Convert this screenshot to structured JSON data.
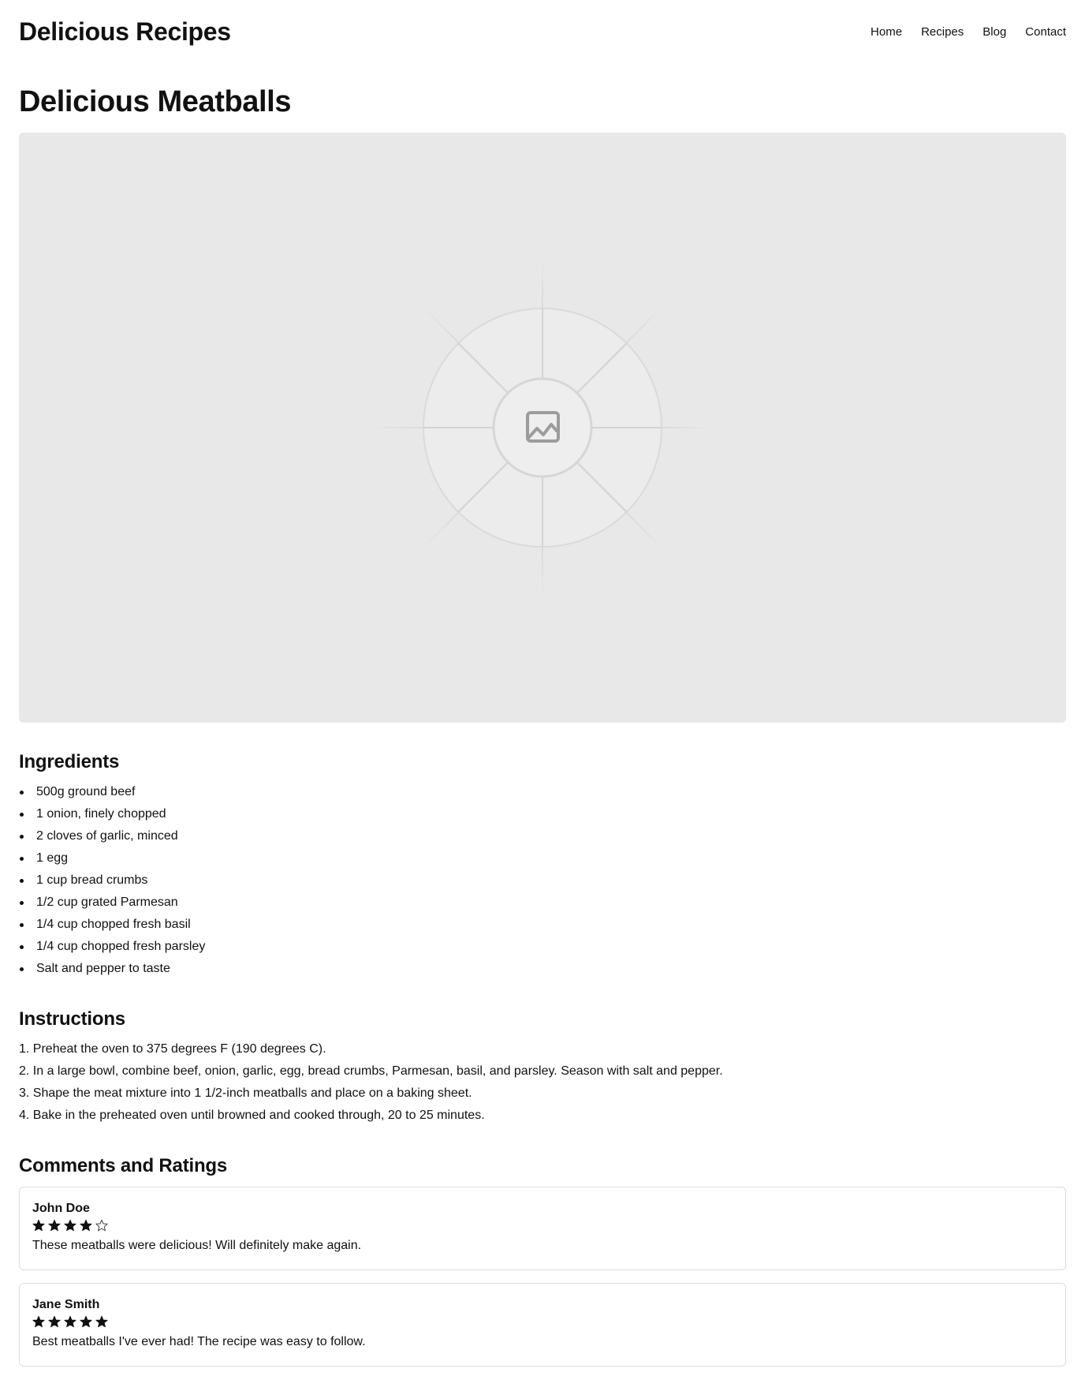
{
  "site": {
    "title": "Delicious Recipes"
  },
  "nav": {
    "items": [
      "Home",
      "Recipes",
      "Blog",
      "Contact"
    ]
  },
  "recipe": {
    "title": "Delicious Meatballs",
    "image_icon": "image-icon",
    "ingredients_heading": "Ingredients",
    "ingredients": [
      "500g ground beef",
      "1 onion, finely chopped",
      "2 cloves of garlic, minced",
      "1 egg",
      "1 cup bread crumbs",
      "1/2 cup grated Parmesan",
      "1/4 cup chopped fresh basil",
      "1/4 cup chopped fresh parsley",
      "Salt and pepper to taste"
    ],
    "instructions_heading": "Instructions",
    "instructions": [
      "1. Preheat the oven to 375 degrees F (190 degrees C).",
      "2. In a large bowl, combine beef, onion, garlic, egg, bread crumbs, Parmesan, basil, and parsley. Season with salt and pepper.",
      "3. Shape the meat mixture into 1 1/2-inch meatballs and place on a baking sheet.",
      "4. Bake in the preheated oven until browned and cooked through, 20 to 25 minutes."
    ]
  },
  "comments": {
    "heading": "Comments and Ratings",
    "items": [
      {
        "author": "John Doe",
        "rating": 4,
        "max_rating": 5,
        "text": "These meatballs were delicious! Will definitely make again."
      },
      {
        "author": "Jane Smith",
        "rating": 5,
        "max_rating": 5,
        "text": "Best meatballs I've ever had! The recipe was easy to follow."
      }
    ]
  },
  "colors": {
    "text": "#111111",
    "placeholder_bg": "#e8e8e8",
    "border": "#dddddd"
  }
}
